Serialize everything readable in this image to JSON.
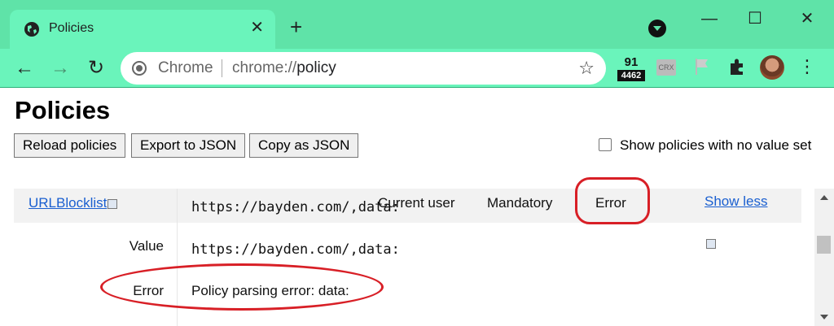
{
  "browser": {
    "tab_title": "Policies",
    "tab_close": "✕",
    "new_tab": "+",
    "omnibox_scheme_label": "Chrome",
    "omnibox_url_prefix": "chrome://",
    "omnibox_url_path": "policy",
    "window_controls": {
      "minimize": "—",
      "maximize": "☐",
      "close": "✕"
    },
    "extension_badge": {
      "top": "91",
      "bottom": "4462"
    },
    "crx_label": "CRX"
  },
  "page": {
    "title": "Policies",
    "buttons": {
      "reload": "Reload policies",
      "export": "Export to JSON",
      "copy": "Copy as JSON"
    },
    "checkbox_label": "Show policies with no value set"
  },
  "policy_row": {
    "name": "URLBlocklist",
    "value_preview": "https://bayden.com/,data:",
    "source": "Current user",
    "level": "Mandatory",
    "status": "Error",
    "toggle": "Show less",
    "details": [
      {
        "label": "Value",
        "value": "https://bayden.com/,data:"
      },
      {
        "label": "Error",
        "value": "Policy parsing error: data:"
      }
    ]
  },
  "annotation_color": "#d81f26",
  "theme_color": "#5fe3a8"
}
